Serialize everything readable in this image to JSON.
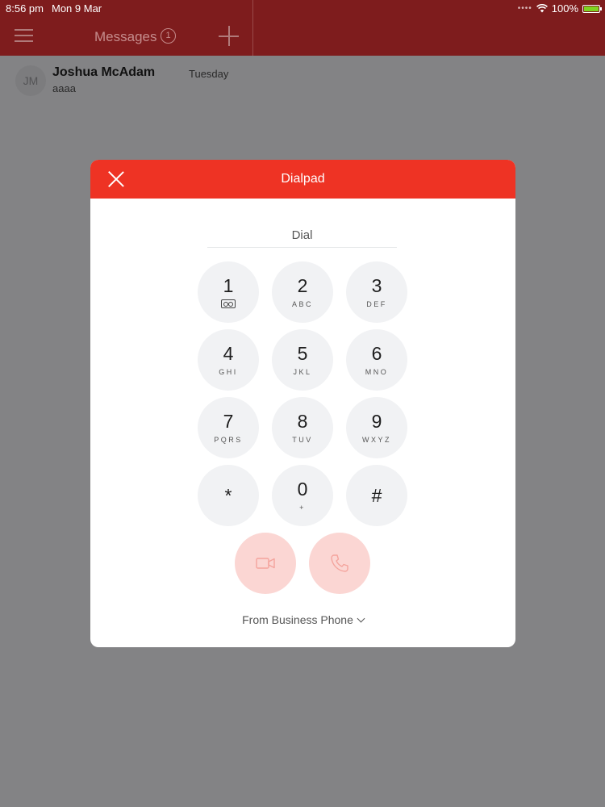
{
  "status_bar": {
    "time": "8:56 pm",
    "date": "Mon 9 Mar",
    "battery": "100%"
  },
  "nav": {
    "title": "Messages",
    "badge": "1"
  },
  "conversation": {
    "initials": "JM",
    "name": "Joshua McAdam",
    "time": "Tuesday",
    "preview": "aaaa"
  },
  "dialpad": {
    "title": "Dialpad",
    "placeholder": "Dial",
    "keys": [
      {
        "digit": "1",
        "letters": "",
        "icon": "voicemail-icon"
      },
      {
        "digit": "2",
        "letters": "ABC"
      },
      {
        "digit": "3",
        "letters": "DEF"
      },
      {
        "digit": "4",
        "letters": "GHI"
      },
      {
        "digit": "5",
        "letters": "JKL"
      },
      {
        "digit": "6",
        "letters": "MNO"
      },
      {
        "digit": "7",
        "letters": "PQRS"
      },
      {
        "digit": "8",
        "letters": "TUV"
      },
      {
        "digit": "9",
        "letters": "WXYZ"
      },
      {
        "digit": "*",
        "letters": ""
      },
      {
        "digit": "0",
        "letters": "+"
      },
      {
        "digit": "#",
        "letters": ""
      }
    ],
    "from_label": "From Business Phone"
  },
  "colors": {
    "header": "#ee3324",
    "nav_bg": "#7e1c1d",
    "key_bg": "#f1f2f4",
    "call_btn_bg": "#fbd6d3"
  }
}
